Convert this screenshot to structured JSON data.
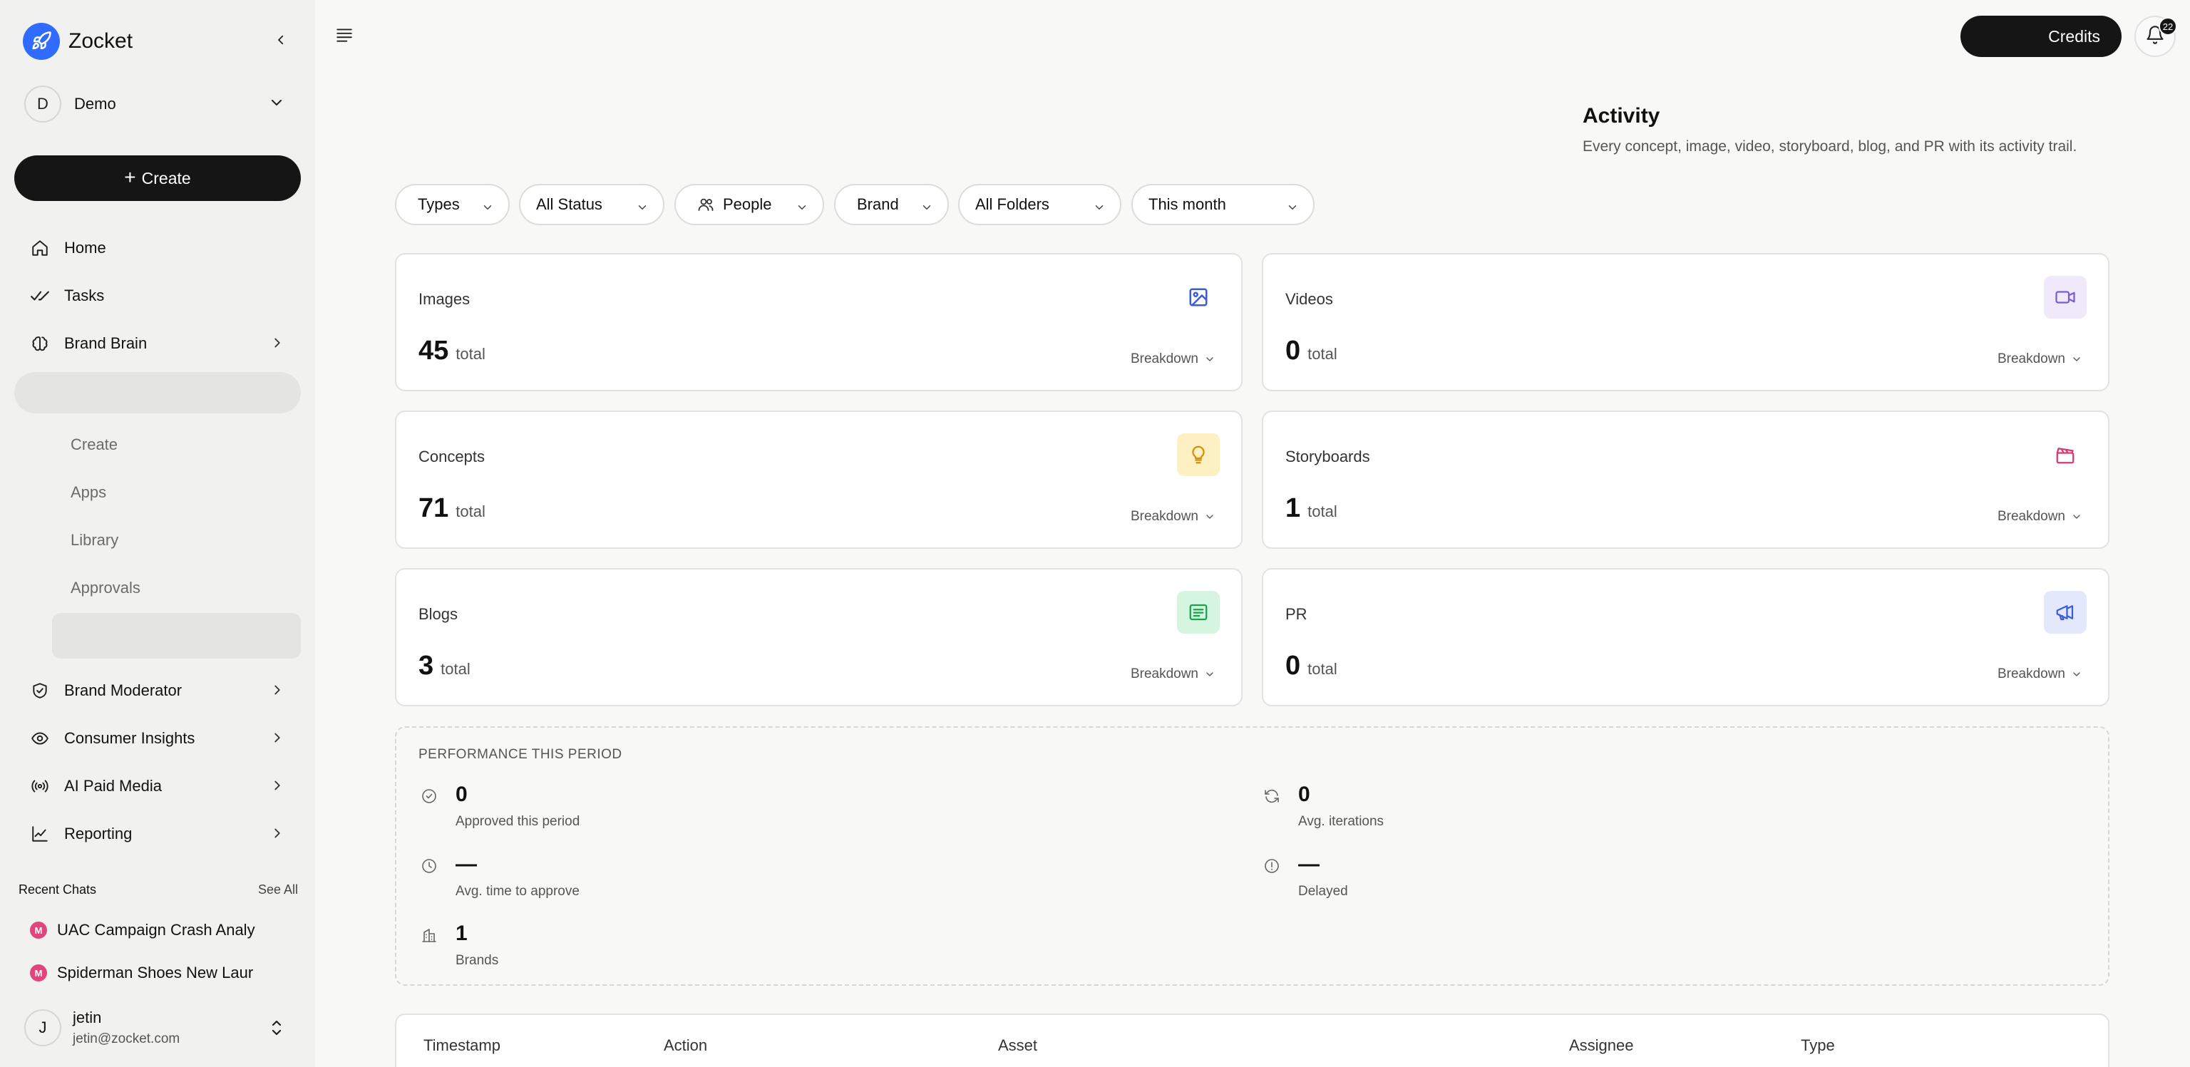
{
  "app": {
    "name": "Zocket"
  },
  "workspace": {
    "initial": "D",
    "name": "Demo"
  },
  "sidebar": {
    "create_label": "Create",
    "nav": [
      {
        "label": "Home"
      },
      {
        "label": "Tasks"
      },
      {
        "label": "Brand Brain"
      }
    ],
    "sub_items": [
      {
        "label": "Create"
      },
      {
        "label": "Apps"
      },
      {
        "label": "Library"
      },
      {
        "label": "Approvals"
      }
    ],
    "nav_lower": [
      {
        "label": "Brand Moderator"
      },
      {
        "label": "Consumer Insights"
      },
      {
        "label": "AI Paid Media"
      },
      {
        "label": "Reporting"
      }
    ],
    "recent_chats": {
      "heading": "Recent Chats",
      "see_all": "See All",
      "items": [
        {
          "badge": "M",
          "label": "UAC Campaign Crash Analy"
        },
        {
          "badge": "M",
          "label": "Spiderman Shoes New Laur"
        }
      ]
    },
    "user": {
      "initial": "J",
      "name": "jetin",
      "email": "jetin@zocket.com"
    }
  },
  "topbar": {
    "credits_label": "Credits",
    "notifications_count": "22"
  },
  "header": {
    "title": "Activity",
    "subtitle": "Every concept, image, video, storyboard, blog, and PR with its activity trail."
  },
  "filters": [
    {
      "label": "Types"
    },
    {
      "label": "All Status"
    },
    {
      "label": "People"
    },
    {
      "label": "Brand"
    },
    {
      "label": "All Folders"
    },
    {
      "label": "This month"
    }
  ],
  "cards": [
    {
      "title": "Images",
      "count": "45",
      "unit": "total",
      "breakdown": "Breakdown",
      "icon": "image-icon",
      "accent": "#3b5bdb"
    },
    {
      "title": "Videos",
      "count": "0",
      "unit": "total",
      "breakdown": "Breakdown",
      "icon": "video-icon",
      "accent": "#7c5cd6"
    },
    {
      "title": "Concepts",
      "count": "71",
      "unit": "total",
      "breakdown": "Breakdown",
      "icon": "lightbulb-icon",
      "accent": "#d98a07"
    },
    {
      "title": "Storyboards",
      "count": "1",
      "unit": "total",
      "breakdown": "Breakdown",
      "icon": "clapperboard-icon",
      "accent": "#d63a6e"
    },
    {
      "title": "Blogs",
      "count": "3",
      "unit": "total",
      "breakdown": "Breakdown",
      "icon": "document-lines-icon",
      "accent": "#16a34a"
    },
    {
      "title": "PR",
      "count": "0",
      "unit": "total",
      "breakdown": "Breakdown",
      "icon": "megaphone-icon",
      "accent": "#3b5bdb"
    }
  ],
  "performance": {
    "title": "PERFORMANCE THIS PERIOD",
    "metrics": [
      {
        "value": "0",
        "label": "Approved this period",
        "icon": "check-circle-icon"
      },
      {
        "value": "0",
        "label": "Avg. iterations",
        "icon": "refresh-icon"
      },
      {
        "value": "—",
        "label": "Avg. time to approve",
        "icon": "clock-icon"
      },
      {
        "value": "—",
        "label": "Delayed",
        "icon": "info-icon"
      },
      {
        "value": "1",
        "label": "Brands",
        "icon": "building-icon"
      }
    ]
  },
  "table": {
    "columns": [
      "Timestamp",
      "Action",
      "Asset",
      "Assignee",
      "Type"
    ]
  }
}
